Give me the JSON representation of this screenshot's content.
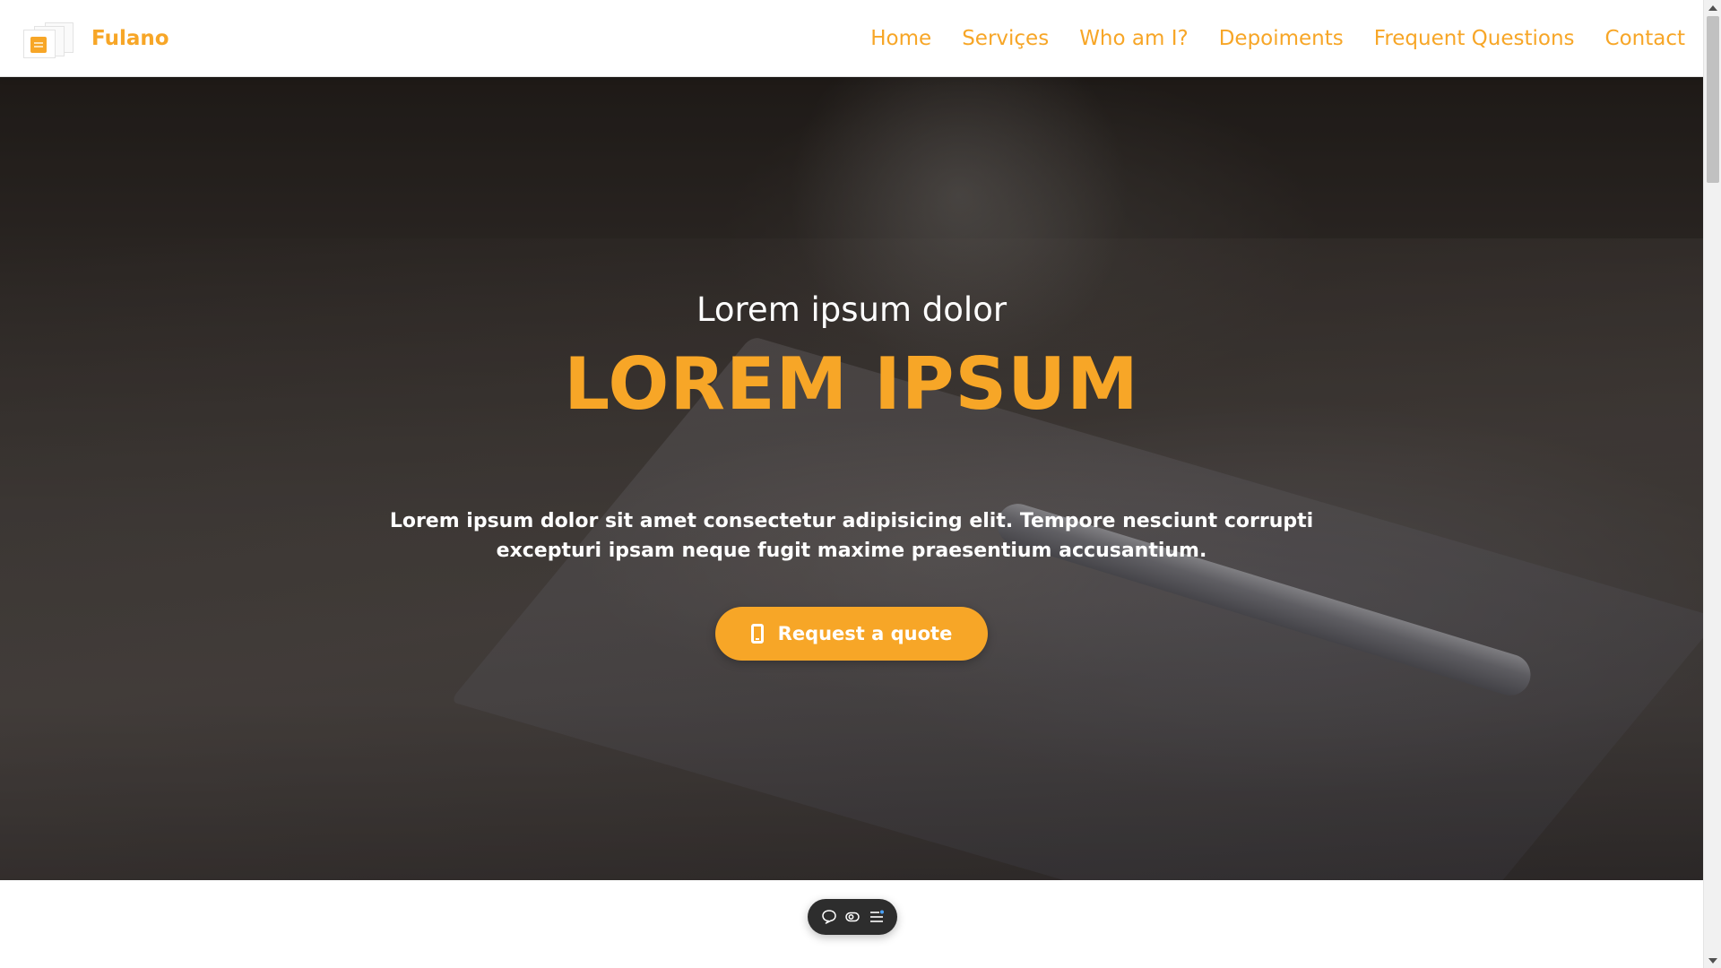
{
  "brand": {
    "name": "Fulano"
  },
  "nav": {
    "items": [
      {
        "label": "Home"
      },
      {
        "label": "Serviçes"
      },
      {
        "label": "Who am I?"
      },
      {
        "label": "Depoiments"
      },
      {
        "label": "Frequent Questions"
      },
      {
        "label": "Contact"
      }
    ]
  },
  "hero": {
    "subtitle": "Lorem ipsum dolor",
    "title": "LOREM IPSUM",
    "text": "Lorem ipsum dolor sit amet consectetur adipisicing elit. Tempore nesciunt corrupti excepturi ipsam neque fugit maxime praesentium accusantium.",
    "cta_label": "Request a quote",
    "cta_icon": "mobile-phone-icon"
  },
  "toolbar": {
    "icons": [
      "chat-bubble-icon",
      "toggle-view-icon",
      "menu-list-icon"
    ]
  },
  "colors": {
    "accent": "#f7a627",
    "nav_background": "#ffffff",
    "toolbar_background": "#2d2d2d"
  }
}
